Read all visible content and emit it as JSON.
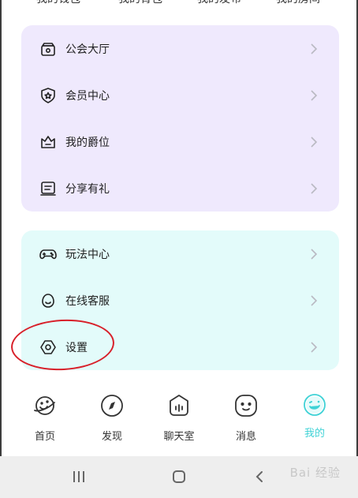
{
  "top_tabs": [
    "我的钱包",
    "我的背包",
    "我的发布",
    "我的房间"
  ],
  "group1": [
    {
      "label": "公会大厅",
      "icon": "guild-hall-icon"
    },
    {
      "label": "会员中心",
      "icon": "member-badge-icon"
    },
    {
      "label": "我的爵位",
      "icon": "crown-icon"
    },
    {
      "label": "分享有礼",
      "icon": "share-gift-icon"
    }
  ],
  "group2": [
    {
      "label": "玩法中心",
      "icon": "gamepad-icon"
    },
    {
      "label": "在线客服",
      "icon": "customer-service-icon"
    },
    {
      "label": "设置",
      "icon": "settings-hex-icon"
    }
  ],
  "bottom_nav": [
    {
      "label": "首页",
      "icon": "planet-icon",
      "active": false
    },
    {
      "label": "发现",
      "icon": "compass-icon",
      "active": false
    },
    {
      "label": "聊天室",
      "icon": "chatroom-icon",
      "active": false
    },
    {
      "label": "消息",
      "icon": "message-face-icon",
      "active": false
    },
    {
      "label": "我的",
      "icon": "profile-face-icon",
      "active": true
    }
  ],
  "colors": {
    "card_purple": "#efe9fd",
    "card_cyan": "#e3fbfa",
    "accent": "#3fd2d6",
    "annotation": "#d8202a"
  },
  "watermark": "Bai 经验"
}
